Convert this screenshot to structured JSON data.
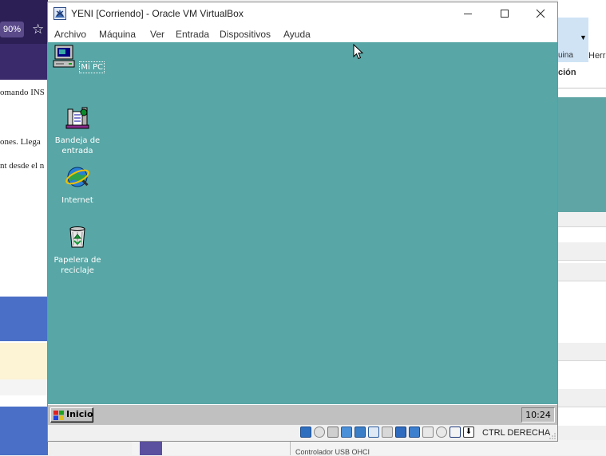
{
  "background": {
    "left_window": {
      "zoom": "90%",
      "star_icon": "star-outline-icon",
      "doc_lines": [
        "omando INS",
        "ones. Llega",
        "nt desde el n"
      ]
    },
    "right_window": {
      "toolbar_labels": [
        "uina",
        "Herr"
      ],
      "section_label": "ción"
    },
    "bottom_strip_text": "Controlador USB       OHCI"
  },
  "vbox": {
    "title": "YENI [Corriendo] - Oracle VM VirtualBox",
    "window_controls": [
      "minimize-icon",
      "maximize-icon",
      "close-icon"
    ],
    "menu": [
      "Archivo",
      "Máquina",
      "Ver",
      "Entrada",
      "Dispositivos",
      "Ayuda"
    ],
    "status_bar": {
      "icons": [
        "hard-disk-icon",
        "optical-drive-icon",
        "floppy-icon",
        "audio-icon",
        "network-icon",
        "usb-icon",
        "shared-folders-icon",
        "display-icon",
        "video-capture-icon",
        "clipboard-icon",
        "mouse-integration-icon",
        "keyboard-icon",
        "host-key-arrow-icon"
      ],
      "host_key": "CTRL DERECHA"
    }
  },
  "guest": {
    "desktop_color": "#58a6a6",
    "icons": [
      {
        "label": "Mi PC",
        "icon": "my-computer-icon",
        "selected": true
      },
      {
        "label_lines": [
          "Bandeja de",
          "entrada"
        ],
        "icon": "inbox-icon"
      },
      {
        "label": "Internet",
        "icon": "internet-explorer-icon"
      },
      {
        "label_lines": [
          "Papelera de",
          "reciclaje"
        ],
        "icon": "recycle-bin-icon"
      }
    ],
    "taskbar": {
      "start_label": "Inicio",
      "clock": "10:24"
    }
  }
}
